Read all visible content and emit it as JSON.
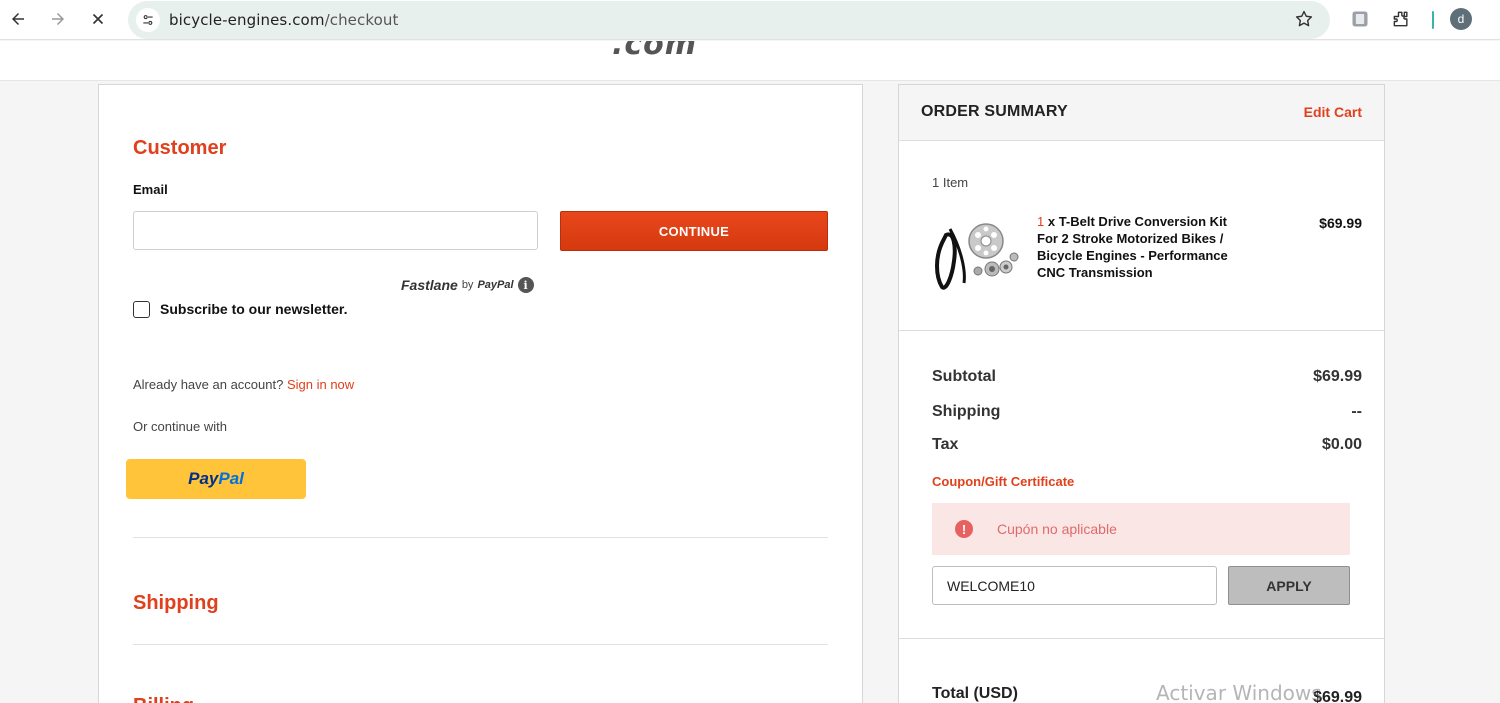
{
  "browser": {
    "url_host": "bicycle-engines.com",
    "url_path": "/checkout",
    "profile_initial": "d"
  },
  "site": {
    "logo_fragment": ".com"
  },
  "customer": {
    "title": "Customer",
    "email_label": "Email",
    "email_value": "",
    "continue_label": "CONTINUE",
    "fastlane_brand": "Fastlane",
    "fastlane_by": "by",
    "fastlane_paypal": "PayPal",
    "newsletter_label": "Subscribe to our newsletter.",
    "newsletter_checked": false,
    "account_prompt": "Already have an account?",
    "sign_in_link": "Sign in now",
    "or_continue": "Or continue with",
    "paypal_pay": "Pay",
    "paypal_pal": "Pal"
  },
  "shipping": {
    "title": "Shipping"
  },
  "billing": {
    "title": "Billing"
  },
  "order_summary": {
    "title": "ORDER SUMMARY",
    "edit_cart": "Edit Cart",
    "item_count": "1 Item",
    "item": {
      "qty": "1",
      "name": "x T-Belt Drive Conversion Kit For 2 Stroke Motorized Bikes / Bicycle Engines - Performance CNC Transmission",
      "price": "$69.99"
    },
    "subtotal_label": "Subtotal",
    "subtotal_value": "$69.99",
    "shipping_label": "Shipping",
    "shipping_value": "--",
    "tax_label": "Tax",
    "tax_value": "$0.00",
    "coupon_link": "Coupon/Gift Certificate",
    "coupon_error": "Cupón no aplicable",
    "coupon_code": "WELCOME10",
    "apply_label": "APPLY",
    "total_label": "Total (USD)",
    "total_value": "$69.99"
  },
  "os_watermark": "Activar Windows",
  "colors": {
    "accent": "#e0401b",
    "paypal_yellow": "#ffc439",
    "alert_bg": "#fbe6e6"
  }
}
